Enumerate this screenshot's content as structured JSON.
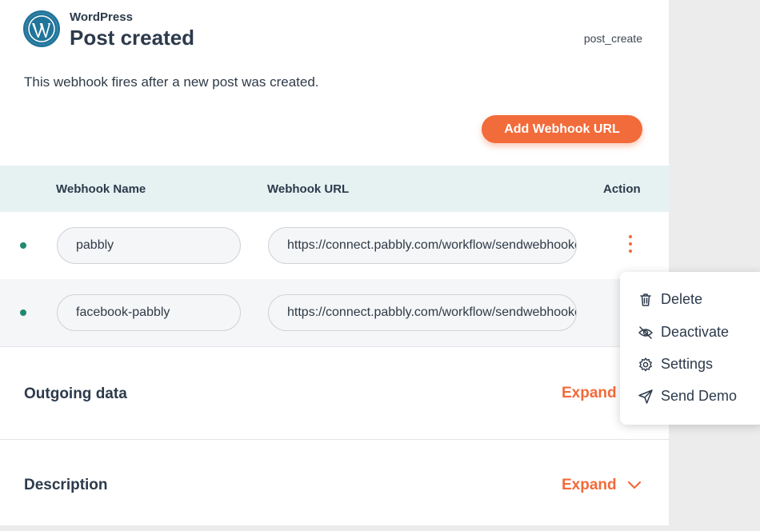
{
  "header": {
    "app_name": "WordPress",
    "event_title": "Post created",
    "event_code": "post_create",
    "description": "This webhook fires after a new post was created.",
    "add_button_label": "Add Webhook URL"
  },
  "table": {
    "columns": [
      "Webhook Name",
      "Webhook URL",
      "Action"
    ],
    "rows": [
      {
        "name": "pabbly",
        "url": "https://connect.pabbly.com/workflow/sendwebhookdata/"
      },
      {
        "name": "facebook-pabbly",
        "url": "https://connect.pabbly.com/workflow/sendwebhookdata/"
      }
    ]
  },
  "menu": {
    "items": [
      {
        "label": "Delete",
        "icon": "trash-icon"
      },
      {
        "label": "Deactivate",
        "icon": "eye-off-icon"
      },
      {
        "label": "Settings",
        "icon": "gear-icon"
      },
      {
        "label": "Send Demo",
        "icon": "send-icon"
      }
    ]
  },
  "sections": [
    {
      "title": "Outgoing data",
      "expand_label": "Expand"
    },
    {
      "title": "Description",
      "expand_label": "Expand"
    }
  ],
  "colors": {
    "accent": "#f26b3a",
    "table_header_bg": "#e6f2f2",
    "active_dot": "#1f8a6f",
    "wordpress_blue": "#21759b"
  }
}
